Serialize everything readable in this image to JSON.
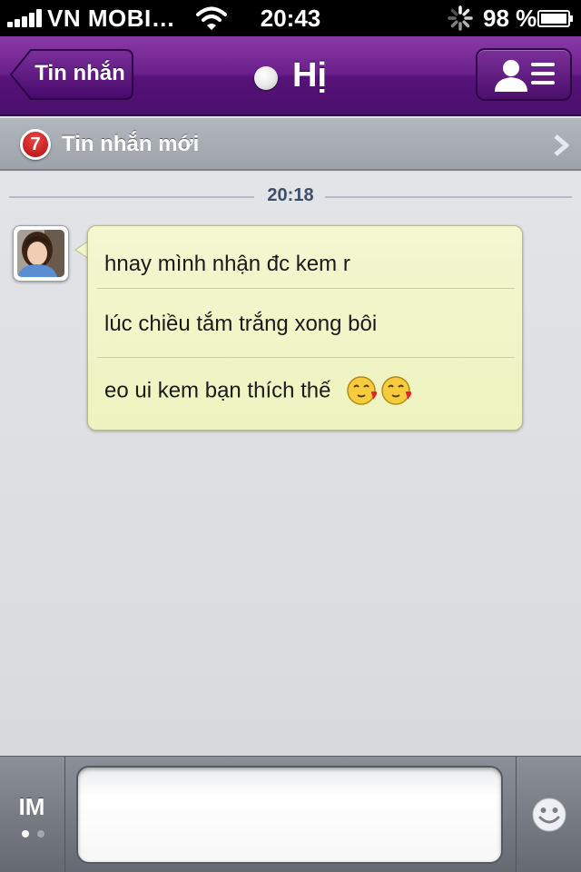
{
  "status_bar": {
    "carrier": "VN MOBI…",
    "time": "20:43",
    "battery_percent": "98 %",
    "signal_bars": 5,
    "icons": [
      "signal-icon",
      "wifi-icon",
      "activity-spinner-icon",
      "battery-icon"
    ]
  },
  "nav": {
    "back_label": "Tin nhắn",
    "title": "Hị",
    "presence_icon": "online-status-icon",
    "contact_icon": "contact-list-icon"
  },
  "new_messages": {
    "count": "7",
    "label": "Tin nhắn mới",
    "chevron_icon": "chevron-right-icon"
  },
  "conversation": {
    "timestamp": "20:18",
    "messages": [
      {
        "text": "hnay mình nhận đc kem r"
      },
      {
        "text": "lúc chiều tắm trắng xong bôi"
      },
      {
        "text": "eo ui kem bạn thích thế",
        "emoticons": [
          "kiss-emoticon",
          "kiss-emoticon"
        ]
      }
    ]
  },
  "input_bar": {
    "im_label": "IM",
    "message_placeholder": "",
    "emoji_icon": "smiley-icon"
  },
  "colors": {
    "nav_purple": "#5e1882",
    "bubble_fill": "#f1f5c6",
    "badge_red": "#cc1b1b",
    "timestamp_text": "#3e4e6a"
  }
}
